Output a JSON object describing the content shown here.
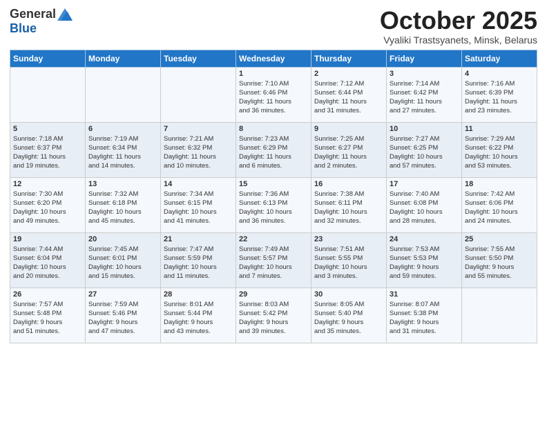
{
  "logo": {
    "general": "General",
    "blue": "Blue"
  },
  "title": "October 2025",
  "subtitle": "Vyaliki Trastsyanets, Minsk, Belarus",
  "headers": [
    "Sunday",
    "Monday",
    "Tuesday",
    "Wednesday",
    "Thursday",
    "Friday",
    "Saturday"
  ],
  "weeks": [
    [
      {
        "day": "",
        "info": ""
      },
      {
        "day": "",
        "info": ""
      },
      {
        "day": "",
        "info": ""
      },
      {
        "day": "1",
        "info": "Sunrise: 7:10 AM\nSunset: 6:46 PM\nDaylight: 11 hours\nand 36 minutes."
      },
      {
        "day": "2",
        "info": "Sunrise: 7:12 AM\nSunset: 6:44 PM\nDaylight: 11 hours\nand 31 minutes."
      },
      {
        "day": "3",
        "info": "Sunrise: 7:14 AM\nSunset: 6:42 PM\nDaylight: 11 hours\nand 27 minutes."
      },
      {
        "day": "4",
        "info": "Sunrise: 7:16 AM\nSunset: 6:39 PM\nDaylight: 11 hours\nand 23 minutes."
      }
    ],
    [
      {
        "day": "5",
        "info": "Sunrise: 7:18 AM\nSunset: 6:37 PM\nDaylight: 11 hours\nand 19 minutes."
      },
      {
        "day": "6",
        "info": "Sunrise: 7:19 AM\nSunset: 6:34 PM\nDaylight: 11 hours\nand 14 minutes."
      },
      {
        "day": "7",
        "info": "Sunrise: 7:21 AM\nSunset: 6:32 PM\nDaylight: 11 hours\nand 10 minutes."
      },
      {
        "day": "8",
        "info": "Sunrise: 7:23 AM\nSunset: 6:29 PM\nDaylight: 11 hours\nand 6 minutes."
      },
      {
        "day": "9",
        "info": "Sunrise: 7:25 AM\nSunset: 6:27 PM\nDaylight: 11 hours\nand 2 minutes."
      },
      {
        "day": "10",
        "info": "Sunrise: 7:27 AM\nSunset: 6:25 PM\nDaylight: 10 hours\nand 57 minutes."
      },
      {
        "day": "11",
        "info": "Sunrise: 7:29 AM\nSunset: 6:22 PM\nDaylight: 10 hours\nand 53 minutes."
      }
    ],
    [
      {
        "day": "12",
        "info": "Sunrise: 7:30 AM\nSunset: 6:20 PM\nDaylight: 10 hours\nand 49 minutes."
      },
      {
        "day": "13",
        "info": "Sunrise: 7:32 AM\nSunset: 6:18 PM\nDaylight: 10 hours\nand 45 minutes."
      },
      {
        "day": "14",
        "info": "Sunrise: 7:34 AM\nSunset: 6:15 PM\nDaylight: 10 hours\nand 41 minutes."
      },
      {
        "day": "15",
        "info": "Sunrise: 7:36 AM\nSunset: 6:13 PM\nDaylight: 10 hours\nand 36 minutes."
      },
      {
        "day": "16",
        "info": "Sunrise: 7:38 AM\nSunset: 6:11 PM\nDaylight: 10 hours\nand 32 minutes."
      },
      {
        "day": "17",
        "info": "Sunrise: 7:40 AM\nSunset: 6:08 PM\nDaylight: 10 hours\nand 28 minutes."
      },
      {
        "day": "18",
        "info": "Sunrise: 7:42 AM\nSunset: 6:06 PM\nDaylight: 10 hours\nand 24 minutes."
      }
    ],
    [
      {
        "day": "19",
        "info": "Sunrise: 7:44 AM\nSunset: 6:04 PM\nDaylight: 10 hours\nand 20 minutes."
      },
      {
        "day": "20",
        "info": "Sunrise: 7:45 AM\nSunset: 6:01 PM\nDaylight: 10 hours\nand 15 minutes."
      },
      {
        "day": "21",
        "info": "Sunrise: 7:47 AM\nSunset: 5:59 PM\nDaylight: 10 hours\nand 11 minutes."
      },
      {
        "day": "22",
        "info": "Sunrise: 7:49 AM\nSunset: 5:57 PM\nDaylight: 10 hours\nand 7 minutes."
      },
      {
        "day": "23",
        "info": "Sunrise: 7:51 AM\nSunset: 5:55 PM\nDaylight: 10 hours\nand 3 minutes."
      },
      {
        "day": "24",
        "info": "Sunrise: 7:53 AM\nSunset: 5:53 PM\nDaylight: 9 hours\nand 59 minutes."
      },
      {
        "day": "25",
        "info": "Sunrise: 7:55 AM\nSunset: 5:50 PM\nDaylight: 9 hours\nand 55 minutes."
      }
    ],
    [
      {
        "day": "26",
        "info": "Sunrise: 7:57 AM\nSunset: 5:48 PM\nDaylight: 9 hours\nand 51 minutes."
      },
      {
        "day": "27",
        "info": "Sunrise: 7:59 AM\nSunset: 5:46 PM\nDaylight: 9 hours\nand 47 minutes."
      },
      {
        "day": "28",
        "info": "Sunrise: 8:01 AM\nSunset: 5:44 PM\nDaylight: 9 hours\nand 43 minutes."
      },
      {
        "day": "29",
        "info": "Sunrise: 8:03 AM\nSunset: 5:42 PM\nDaylight: 9 hours\nand 39 minutes."
      },
      {
        "day": "30",
        "info": "Sunrise: 8:05 AM\nSunset: 5:40 PM\nDaylight: 9 hours\nand 35 minutes."
      },
      {
        "day": "31",
        "info": "Sunrise: 8:07 AM\nSunset: 5:38 PM\nDaylight: 9 hours\nand 31 minutes."
      },
      {
        "day": "",
        "info": ""
      }
    ]
  ]
}
